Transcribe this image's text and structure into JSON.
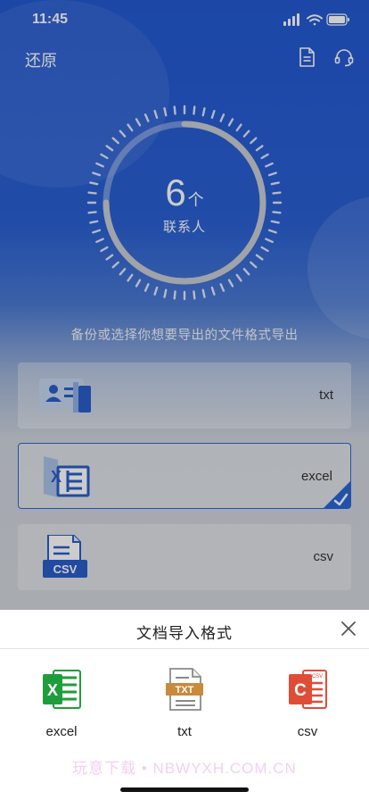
{
  "status_bar": {
    "time": "11:45"
  },
  "nav": {
    "title": "还原",
    "doc_icon": "document-icon",
    "support_icon": "headset-icon"
  },
  "summary": {
    "count": "6",
    "unit": "个",
    "label": "联系人",
    "progress": 0.75
  },
  "hint": "备份或选择你想要导出的文件格式导出",
  "formats": [
    {
      "label": "txt",
      "icon": "contact-card-icon",
      "selected": false
    },
    {
      "label": "excel",
      "icon": "excel-file-icon",
      "selected": true
    },
    {
      "label": "csv",
      "icon": "csv-file-icon",
      "selected": false
    }
  ],
  "sheet": {
    "title": "文档导入格式",
    "options": [
      {
        "label": "excel",
        "icon": "excel-icon"
      },
      {
        "label": "txt",
        "icon": "txt-icon"
      },
      {
        "label": "csv",
        "icon": "csv-icon"
      }
    ],
    "watermark": "玩意下载 • NBWYXH.COM.CN"
  },
  "colors": {
    "primary": "#2359d1",
    "accent": "#2b66d6",
    "excel": "#1e9e3a",
    "txt": "#c98a3c",
    "csv": "#e04d36"
  }
}
